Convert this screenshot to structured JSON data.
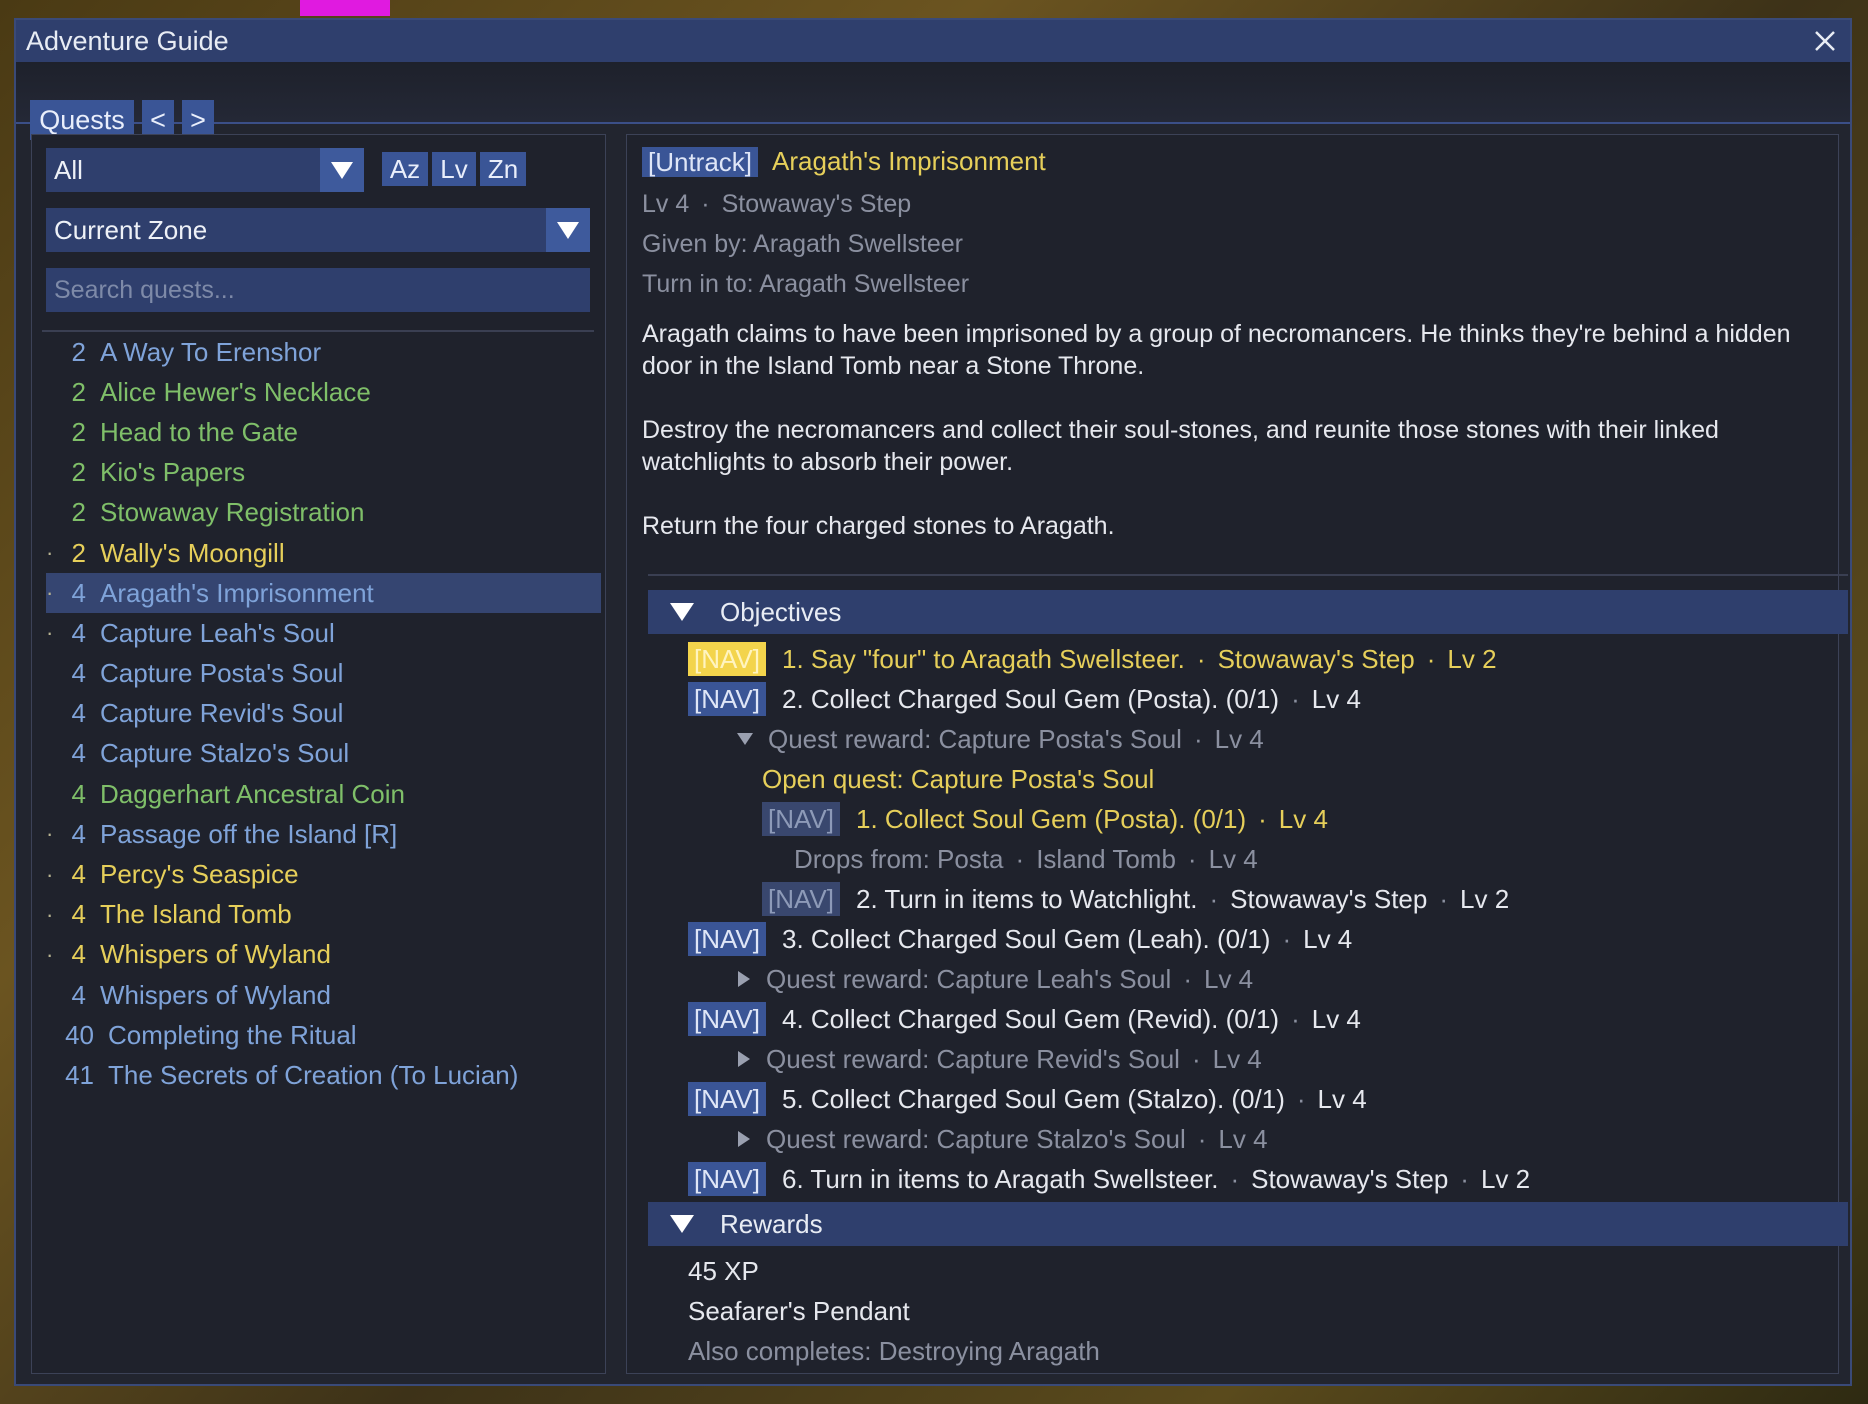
{
  "window": {
    "title": "Adventure Guide"
  },
  "tabs": {
    "quests": "Quests",
    "prev": "<",
    "next": ">"
  },
  "filters": {
    "category": "All",
    "sort_az": "Az",
    "sort_lv": "Lv",
    "sort_zn": "Zn",
    "zone": "Current Zone",
    "search_placeholder": "Search quests..."
  },
  "quests": [
    {
      "level": "2",
      "name": "A Way To Erenshor",
      "color": "#7fa3d9",
      "tracked": false
    },
    {
      "level": "2",
      "name": "Alice Hewer's Necklace",
      "color": "#7fbf69",
      "tracked": false
    },
    {
      "level": "2",
      "name": "Head to the Gate",
      "color": "#7fbf69",
      "tracked": false
    },
    {
      "level": "2",
      "name": "Kio's Papers",
      "color": "#7fbf69",
      "tracked": false
    },
    {
      "level": "2",
      "name": "Stowaway Registration",
      "color": "#7fbf69",
      "tracked": false
    },
    {
      "level": "2",
      "name": "Wally's Moongill",
      "color": "#e6cf5a",
      "tracked": true
    },
    {
      "level": "4",
      "name": "Aragath's Imprisonment",
      "color": "#7fa3d9",
      "tracked": true,
      "selected": true
    },
    {
      "level": "4",
      "name": "Capture Leah's Soul",
      "color": "#7fa3d9",
      "tracked": true
    },
    {
      "level": "4",
      "name": "Capture Posta's Soul",
      "color": "#7fa3d9",
      "tracked": false
    },
    {
      "level": "4",
      "name": "Capture Revid's Soul",
      "color": "#7fa3d9",
      "tracked": false
    },
    {
      "level": "4",
      "name": "Capture Stalzo's Soul",
      "color": "#7fa3d9",
      "tracked": false
    },
    {
      "level": "4",
      "name": "Daggerhart Ancestral Coin",
      "color": "#7fbf69",
      "tracked": false
    },
    {
      "level": "4",
      "name": "Passage off the Island [R]",
      "color": "#7fa3d9",
      "tracked": true
    },
    {
      "level": "4",
      "name": "Percy's Seaspice",
      "color": "#e6cf5a",
      "tracked": true
    },
    {
      "level": "4",
      "name": "The Island Tomb",
      "color": "#e6cf5a",
      "tracked": true
    },
    {
      "level": "4",
      "name": "Whispers of Wyland",
      "color": "#e6cf5a",
      "tracked": true
    },
    {
      "level": "4",
      "name": "Whispers of Wyland",
      "color": "#7fa3d9",
      "tracked": false
    },
    {
      "level": "40",
      "name": "Completing the Ritual",
      "color": "#7fa3d9",
      "tracked": false
    },
    {
      "level": "41",
      "name": "The Secrets of Creation (To Lucian)",
      "color": "#7fa3d9",
      "tracked": false
    }
  ],
  "detail": {
    "untrack": "[Untrack]",
    "title": "Aragath's Imprisonment",
    "level": "Lv 4",
    "dot": "·",
    "zone": "Stowaway's Step",
    "given_by": "Given by: Aragath Swellsteer",
    "turn_in": "Turn in to: Aragath Swellsteer",
    "desc1": "Aragath claims to have been imprisoned by a group of necromancers. He thinks they're behind a hidden door in the Island Tomb near a Stone Throne.",
    "desc2": "Destroy the necromancers and collect their soul-stones, and reunite those stones with their linked watchlights to absorb their power.",
    "desc3": "Return the four charged stones to Aragath."
  },
  "objectives": {
    "header": "Objectives",
    "nav": "[NAV]",
    "o1": {
      "text": "1. Say \"four\" to Aragath Swellsteer.",
      "zone": "Stowaway's Step",
      "lv": "Lv 2"
    },
    "o2": {
      "text": "2. Collect Charged Soul Gem (Posta). (0/1)",
      "lv": "Lv 4"
    },
    "o2_reward": {
      "text": "Quest reward: Capture Posta's Soul",
      "lv": "Lv 4"
    },
    "o2_open": "Open quest: Capture Posta's Soul",
    "o2_sub1": {
      "text": "1. Collect Soul Gem (Posta). (0/1)",
      "lv": "Lv 4"
    },
    "o2_sub1_drops": {
      "text": "Drops from: Posta",
      "zone": "Island Tomb",
      "lv": "Lv 4"
    },
    "o2_sub2": {
      "text": "2. Turn in items to Watchlight.",
      "zone": "Stowaway's Step",
      "lv": "Lv 2"
    },
    "o3": {
      "text": "3. Collect Charged Soul Gem (Leah). (0/1)",
      "lv": "Lv 4"
    },
    "o3_reward": {
      "text": "Quest reward: Capture Leah's Soul",
      "lv": "Lv 4"
    },
    "o4": {
      "text": "4. Collect Charged Soul Gem (Revid). (0/1)",
      "lv": "Lv 4"
    },
    "o4_reward": {
      "text": "Quest reward: Capture Revid's Soul",
      "lv": "Lv 4"
    },
    "o5": {
      "text": "5. Collect Charged Soul Gem (Stalzo). (0/1)",
      "lv": "Lv 4"
    },
    "o5_reward": {
      "text": "Quest reward: Capture Stalzo's Soul",
      "lv": "Lv 4"
    },
    "o6": {
      "text": "6. Turn in items to Aragath Swellsteer.",
      "zone": "Stowaway's Step",
      "lv": "Lv 2"
    }
  },
  "rewards": {
    "header": "Rewards",
    "xp": "45 XP",
    "item": "Seafarer's Pendant",
    "also": "Also completes: Destroying Aragath"
  },
  "colors": {
    "accent": "#3a5596",
    "panel": "#1f222c",
    "title_bar": "#2f3f6d",
    "quest_yellow": "#e6cf5a",
    "quest_green": "#7fbf69",
    "quest_blue": "#7fa3d9"
  }
}
